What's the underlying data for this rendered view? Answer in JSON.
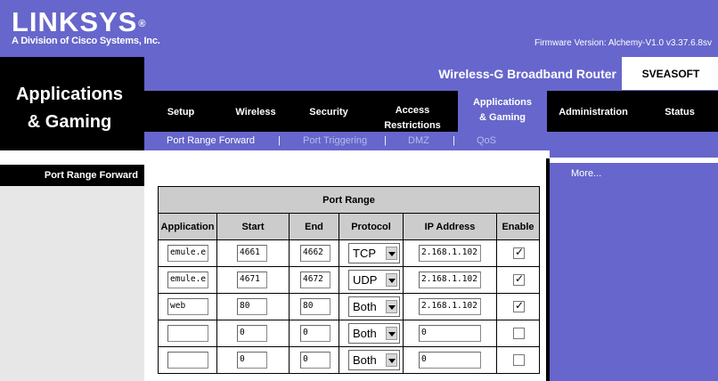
{
  "brand": {
    "logo_text": "LINKSYS",
    "logo_reg": "®",
    "subtitle": "A Division of Cisco Systems, Inc."
  },
  "firmware": "Firmware Version: Alchemy-V1.0 v3.37.6.8sv",
  "section_title": "Applications\n& Gaming",
  "product_name": "Wireless-G Broadband Router",
  "model": "SVEASOFT",
  "tabs": [
    {
      "label": "Setup"
    },
    {
      "label": "Wireless"
    },
    {
      "label": "Security"
    },
    {
      "label": "Access\nRestrictions"
    },
    {
      "label": "Applications\n& Gaming",
      "active": true
    },
    {
      "label": "Administration"
    },
    {
      "label": "Status"
    }
  ],
  "subtabs": [
    {
      "label": "Port Range Forward",
      "active": true
    },
    {
      "label": "Port Triggering"
    },
    {
      "label": "DMZ"
    },
    {
      "label": "QoS"
    }
  ],
  "subtab_separator": "|",
  "left_label": "Port Range Forward",
  "more_link": "More...",
  "colors": {
    "accent": "#6666cc",
    "header_gray": "#cccccc",
    "black": "#000000"
  },
  "port_range": {
    "title": "Port Range",
    "columns": [
      "Application",
      "Start",
      "End",
      "Protocol",
      "IP Address",
      "Enable"
    ],
    "rows": [
      {
        "app": "emule.e",
        "start": "4661",
        "end": "4662",
        "protocol": "TCP",
        "ip": "2.168.1.102",
        "enabled": true
      },
      {
        "app": "emule.e",
        "start": "4671",
        "end": "4672",
        "protocol": "UDP",
        "ip": "2.168.1.102",
        "enabled": true
      },
      {
        "app": "web",
        "start": "80",
        "end": "80",
        "protocol": "Both",
        "ip": "2.168.1.102",
        "enabled": true
      },
      {
        "app": "",
        "start": "0",
        "end": "0",
        "protocol": "Both",
        "ip": "0",
        "enabled": false
      },
      {
        "app": "",
        "start": "0",
        "end": "0",
        "protocol": "Both",
        "ip": "0",
        "enabled": false
      }
    ]
  }
}
